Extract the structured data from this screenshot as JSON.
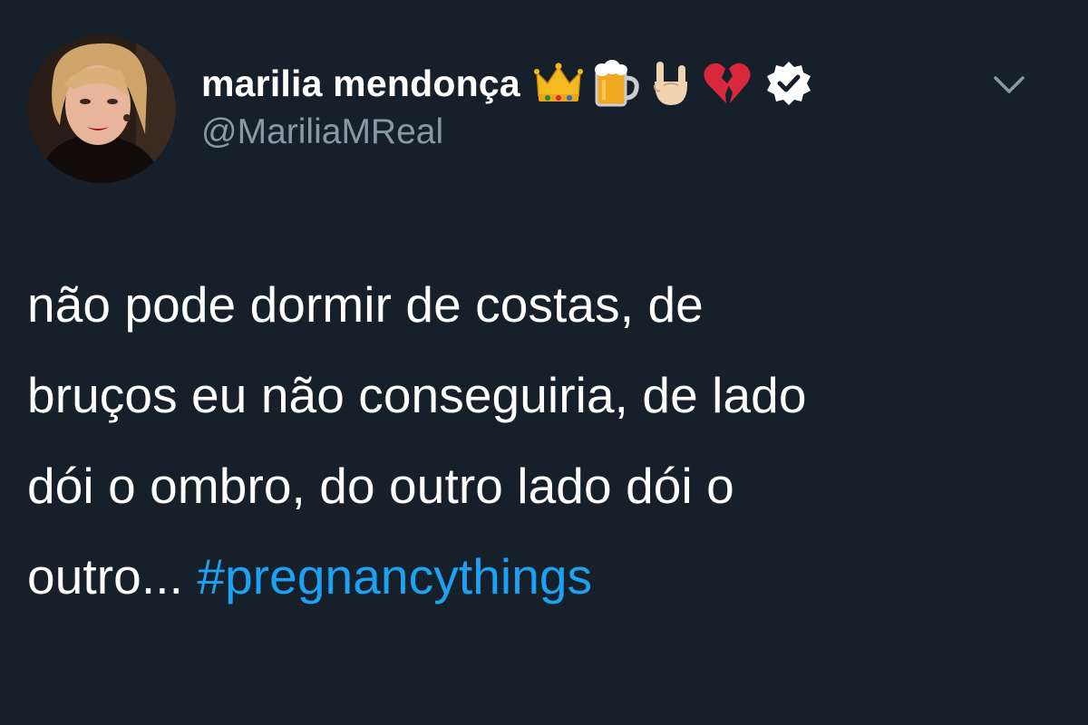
{
  "tweet": {
    "author": {
      "display_name": "marilia mendonça",
      "handle": "@MariliaMReal",
      "name_emojis": [
        "crown-emoji",
        "beer-mug-emoji",
        "sign-of-horns-emoji",
        "broken-heart-emoji"
      ],
      "verified_icon": "verified-badge-icon"
    },
    "menu_icon": "chevron-down-icon",
    "text_lines": [
      "não pode dormir de costas, de",
      "bruços eu não conseguiria, de lado",
      "dói o ombro, do outro lado dói o",
      "outro... "
    ],
    "hashtag": "#pregnancythings"
  },
  "colors": {
    "background": "#15202b",
    "text": "#ffffff",
    "secondary_text": "#8899a6",
    "link": "#1da1f2"
  }
}
